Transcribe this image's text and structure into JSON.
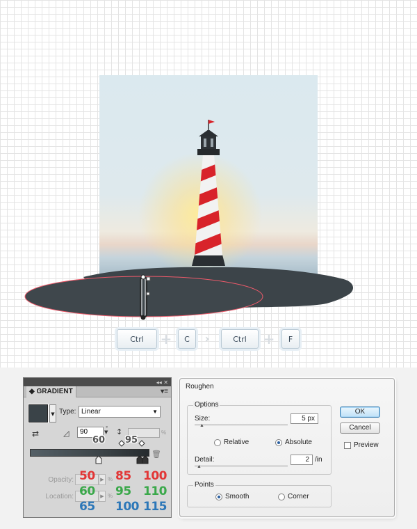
{
  "shortcuts": {
    "step1_key1": "Ctrl",
    "step1_key2": "C",
    "step2_key1": "Ctrl",
    "step2_key2": "F"
  },
  "gradient_panel": {
    "title": "GRADIENT",
    "type_label": "Type:",
    "type_value": "Linear",
    "angle_value": "90",
    "angle_unit": "°",
    "percent": "%",
    "opacity_label": "Opacity:",
    "location_label": "Location:",
    "angle_overlay": "60",
    "aspect_overlay": "95",
    "swatch_color": "#3a4348"
  },
  "annotations": {
    "row1": [
      "50",
      "85",
      "100"
    ],
    "row2": [
      "60",
      "95",
      "110"
    ],
    "row3": [
      "65",
      "100",
      "115"
    ],
    "colors": {
      "red": "#e23636",
      "green": "#3aa84a",
      "blue": "#2c77b8"
    }
  },
  "roughen_dialog": {
    "title": "Roughen",
    "options_title": "Options",
    "size_label": "Size:",
    "size_value": "5 px",
    "relative_label": "Relative",
    "absolute_label": "Absolute",
    "relative_selected": false,
    "absolute_selected": true,
    "detail_label": "Detail:",
    "detail_value": "2",
    "detail_unit": "/in",
    "points_title": "Points",
    "smooth_label": "Smooth",
    "corner_label": "Corner",
    "smooth_selected": true,
    "ok_label": "OK",
    "cancel_label": "Cancel",
    "preview_label": "Preview",
    "preview_checked": false
  },
  "icons": {
    "panel_menu": "panel-menu-icon",
    "reverse": "reverse-gradient-icon",
    "angle": "angle-icon",
    "aspect": "aspect-ratio-icon",
    "delete": "trash-icon"
  }
}
